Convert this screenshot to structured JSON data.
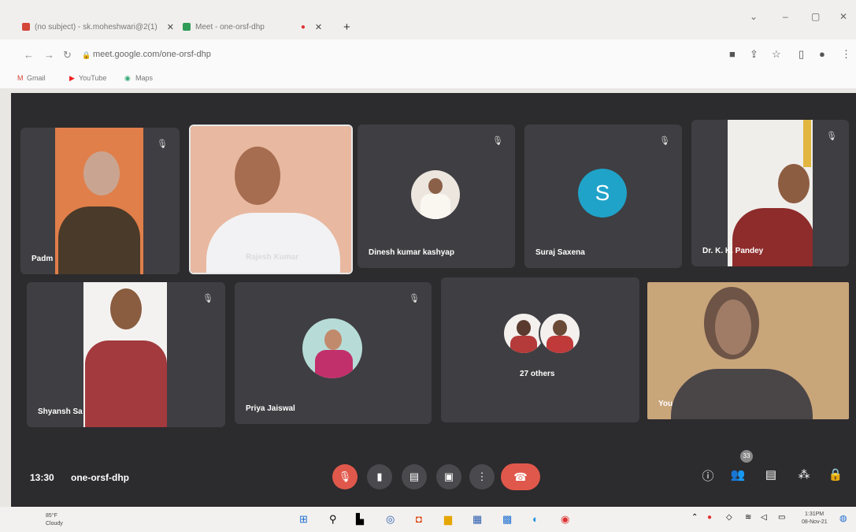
{
  "browser": {
    "tabs": [
      {
        "title": "(no subject) - sk.moheshwari@2(1)"
      },
      {
        "title": "Meet - one-orsf-dhp"
      }
    ],
    "url": "meet.google.com/one-orsf-dhp",
    "bookmarks": [
      "Gmail",
      "YouTube",
      "Maps"
    ]
  },
  "participants": [
    {
      "name": "Padm"
    },
    {
      "name": "Rajesh Kumar"
    },
    {
      "name": "Dinesh kumar kashyap"
    },
    {
      "name": "Suraj Saxena",
      "initial": "S"
    },
    {
      "name": "Dr. K. K. Pandey"
    },
    {
      "name": "Shyansh Sa"
    },
    {
      "name": "Priya Jaiswal"
    },
    {
      "name": "27 others"
    },
    {
      "name": "You"
    }
  ],
  "meeting": {
    "time": "13:30",
    "code": "one-orsf-dhp",
    "people_count": "33"
  },
  "taskbar": {
    "weather_temp": "85°F",
    "weather_text": "Cloudy",
    "clock_time": "1:31PM",
    "clock_date": "08-Nov-21"
  },
  "colors": {
    "meet_bg": "#2c2b2e",
    "tile_bg": "#3f3e42",
    "end_call": "#e0584b",
    "avatar_letter_bg": "#1fa3c9"
  }
}
